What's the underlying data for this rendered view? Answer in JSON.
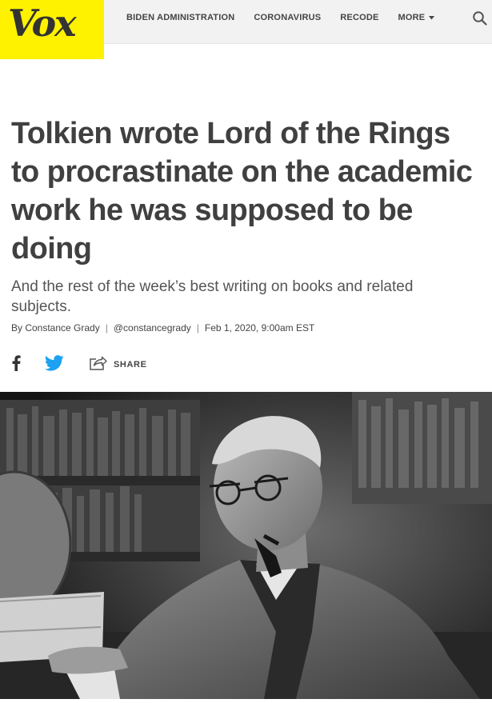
{
  "brand": {
    "logo_text": "Vox",
    "logo_color": "#fff200"
  },
  "nav": {
    "items": [
      {
        "label": "BIDEN ADMINISTRATION"
      },
      {
        "label": "CORONAVIRUS"
      },
      {
        "label": "RECODE"
      },
      {
        "label": "MORE"
      }
    ],
    "search_icon": "search-icon"
  },
  "article": {
    "headline": "Tolkien wrote Lord of the Rings to procrastinate on the academic work he was supposed to be doing",
    "dek": "And the rest of the week’s best writing on books and related subjects.",
    "byline": {
      "author": "By Constance Grady",
      "handle": "@constancegrady",
      "date": "Feb 1, 2020, 9:00am EST"
    },
    "share": {
      "facebook_icon": "facebook-icon",
      "twitter_icon": "twitter-icon",
      "share_label": "SHARE"
    },
    "hero_image": {
      "description_icon": "photo"
    }
  },
  "colors": {
    "accent": "#fff200",
    "twitter": "#1da1f2",
    "headline": "#404040"
  }
}
